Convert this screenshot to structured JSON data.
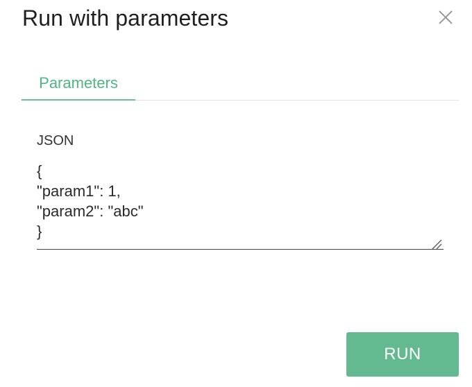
{
  "dialog": {
    "title": "Run with parameters",
    "close_icon": "close-icon"
  },
  "tabs": [
    {
      "label": "Parameters",
      "active": true
    }
  ],
  "form": {
    "json_label": "JSON",
    "json_value": "{\n\"param1\": 1,\n\"param2\": \"abc\"\n}"
  },
  "footer": {
    "run_label": "RUN"
  },
  "colors": {
    "accent": "#4fb583",
    "button_bg": "#63b990",
    "divider": "#e3e3e3"
  }
}
